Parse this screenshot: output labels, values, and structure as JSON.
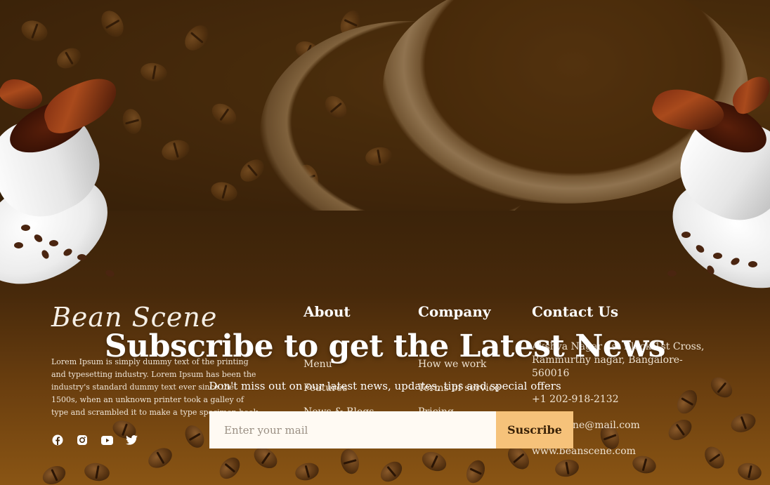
{
  "brand": {
    "logo_text": "Bean Scene"
  },
  "about_text": "Lorem Ipsum is simply dummy text of the printing and typesetting industry. Lorem Ipsum has been the industry's standard dummy text ever since the 1500s, when an unknown printer took a galley of type and scrambled it to make a type specimen book.",
  "social": [
    "facebook-icon",
    "instagram-icon",
    "youtube-icon",
    "twitter-icon"
  ],
  "columns": {
    "about": {
      "title": "About",
      "links": [
        "Menu",
        "Features",
        "News & Blogs"
      ]
    },
    "company": {
      "title": "Company",
      "links": [
        "How we work",
        "Terms of service",
        "Pricing"
      ]
    },
    "contact": {
      "title": "Contact Us",
      "address": "Akshya Nagar 1st Block 1st Cross, Rammurthy nagar, Bangalore-560016",
      "phone": "+1 202-918-2132",
      "email": "beanscene@mail.com",
      "website": "www.beanscene.com"
    }
  },
  "subscribe": {
    "title": "Subscribe to get the Latest News",
    "description": "Don't miss out on our latest news, updates, tips and special offers",
    "placeholder": "Enter your mail",
    "button": "Suscribe"
  },
  "colors": {
    "accent": "#f6c27a",
    "background": "#3a2208",
    "input_bg": "#fffaf3"
  }
}
